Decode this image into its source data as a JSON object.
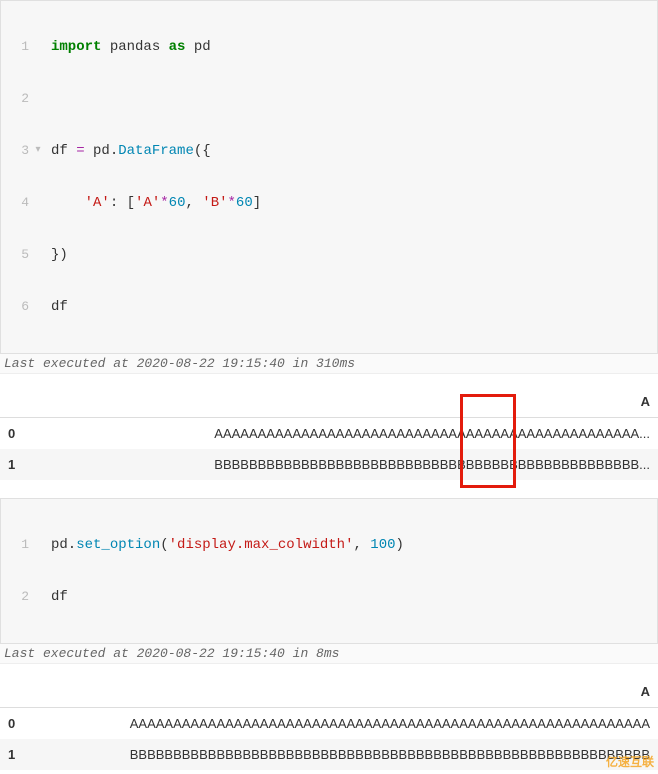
{
  "cell1": {
    "lines": {
      "l1_num": "1",
      "l1_import": "import",
      "l1_pandas": " pandas ",
      "l1_as": "as",
      "l1_pd": " pd",
      "l2_num": "2",
      "l3_num": "3",
      "l3_df": "df ",
      "l3_eq": "=",
      "l3_pd": " pd.",
      "l3_dataframe": "DataFrame",
      "l3_open": "({",
      "l4_num": "4",
      "l4_indent": "    ",
      "l4_keyA": "'A'",
      "l4_colon": ": [",
      "l4_strA": "'A'",
      "l4_mul1": "*",
      "l4_num60a": "60",
      "l4_comma": ", ",
      "l4_strB": "'B'",
      "l4_mul2": "*",
      "l4_num60b": "60",
      "l4_close": "]",
      "l5_num": "5",
      "l5_close": "})",
      "l6_num": "6",
      "l6_df": "df"
    },
    "exec_info": "Last executed at 2020-08-22 19:15:40 in 310ms"
  },
  "output1": {
    "col_header": "A",
    "rows": {
      "r0_idx": "0",
      "r0_val": "AAAAAAAAAAAAAAAAAAAAAAAAAAAAAAAAAAAAAAAAAAAAAAAAA...",
      "r1_idx": "1",
      "r1_val": "BBBBBBBBBBBBBBBBBBBBBBBBBBBBBBBBBBBBBBBBBBBBBBBBB..."
    }
  },
  "cell2": {
    "lines": {
      "l1_num": "1",
      "l1_pd": "pd.",
      "l1_setopt": "set_option",
      "l1_open": "(",
      "l1_arg1": "'display.max_colwidth'",
      "l1_comma": ", ",
      "l1_arg2": "100",
      "l1_close": ")",
      "l2_num": "2",
      "l2_df": "df"
    },
    "exec_info": "Last executed at 2020-08-22 19:15:40 in 8ms"
  },
  "output2": {
    "col_header": "A",
    "rows": {
      "r0_idx": "0",
      "r0_val": "AAAAAAAAAAAAAAAAAAAAAAAAAAAAAAAAAAAAAAAAAAAAAAAAAAAAAAAAAAAA",
      "r1_idx": "1",
      "r1_val": "BBBBBBBBBBBBBBBBBBBBBBBBBBBBBBBBBBBBBBBBBBBBBBBBBBBBBBBBBBBB"
    }
  },
  "watermark": "亿速互联"
}
